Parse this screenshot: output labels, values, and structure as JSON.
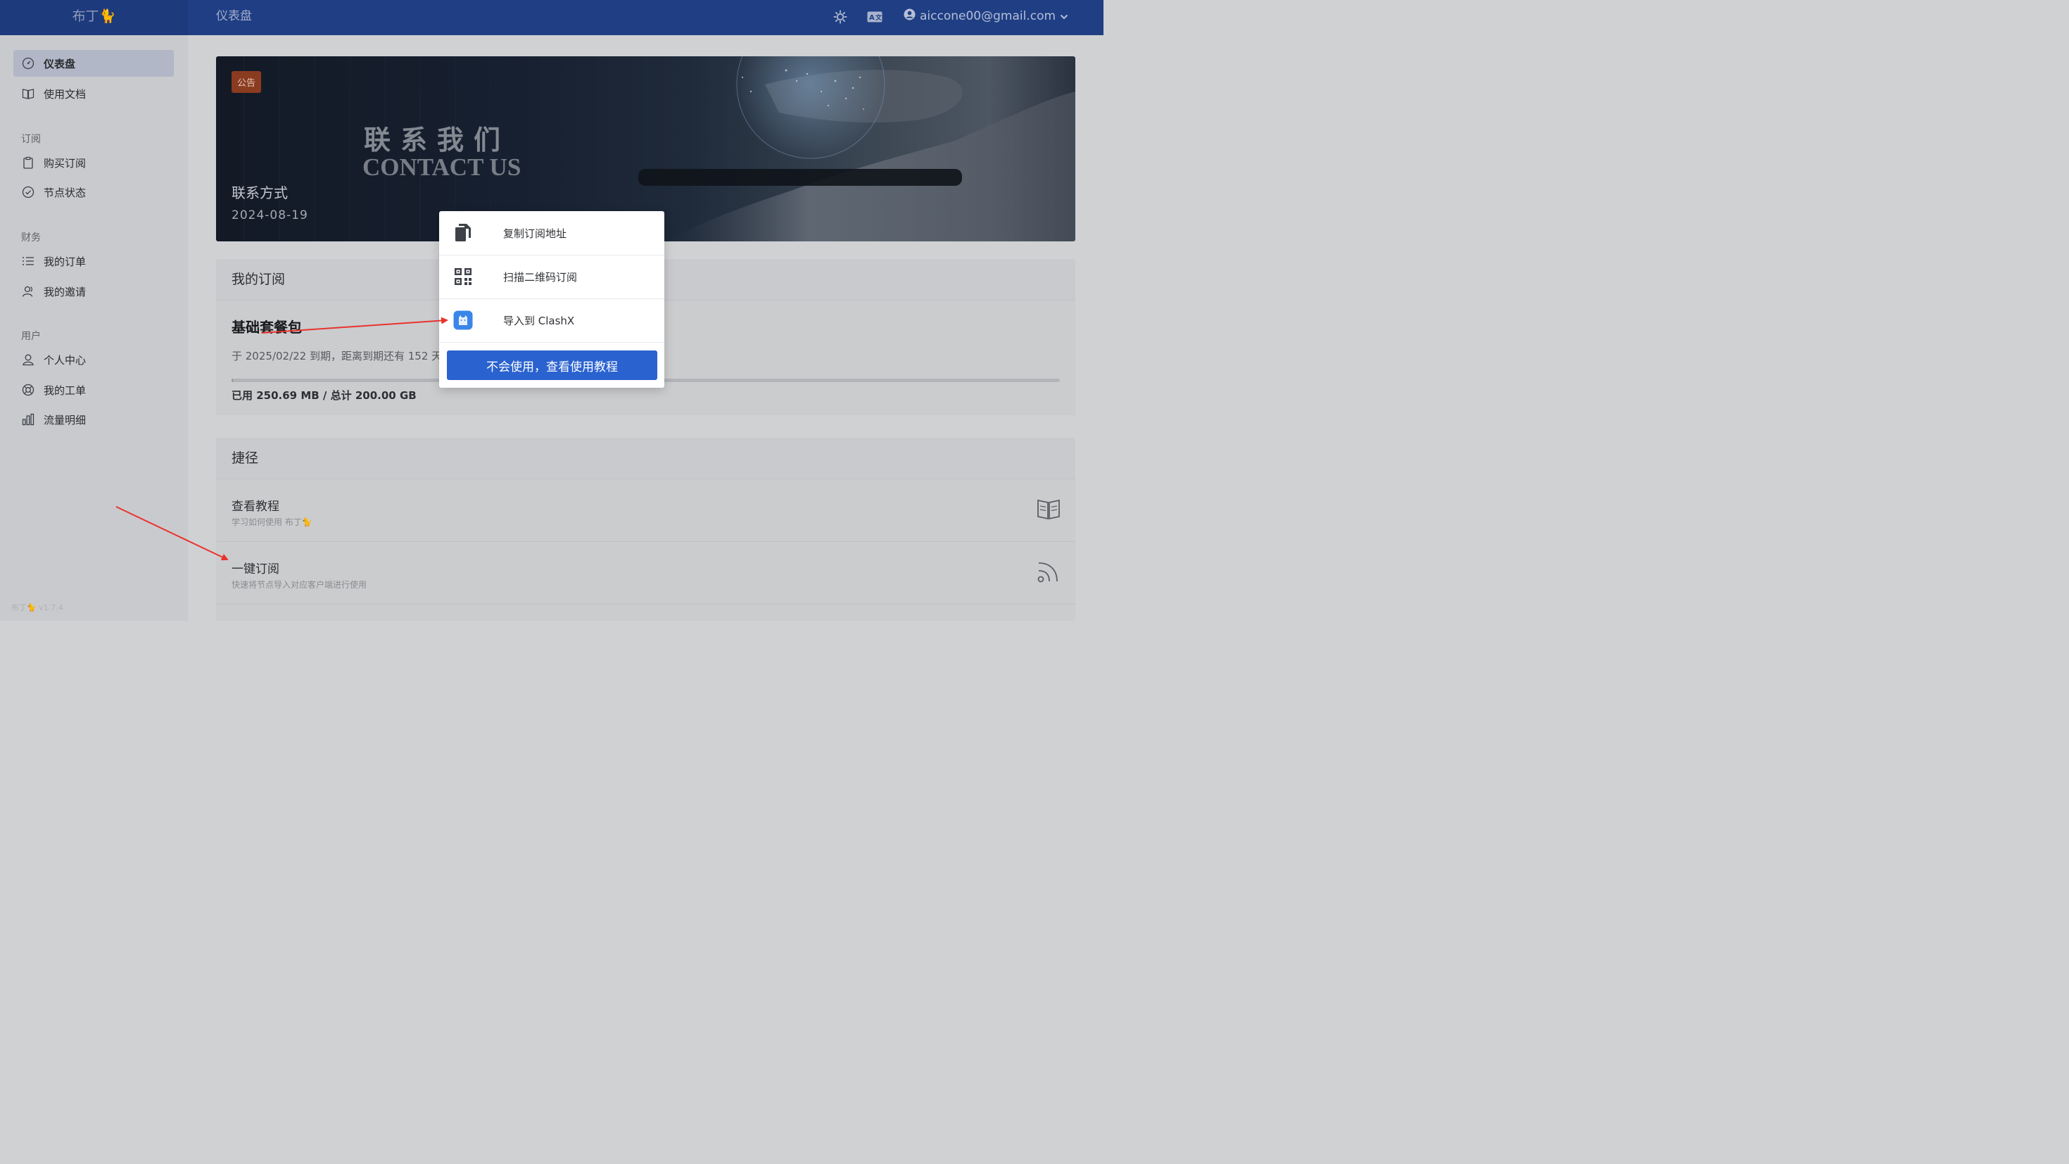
{
  "header": {
    "brand": "布丁🐈",
    "page_title": "仪表盘",
    "user_email": "aiccone00@gmail.com",
    "icons": [
      "theme-sun-icon",
      "language-translate-icon",
      "user-circle-icon",
      "chevron-down-icon"
    ]
  },
  "sidebar": {
    "items": [
      {
        "label": "仪表盘",
        "icon": "dashboard-gauge-icon",
        "active": true
      },
      {
        "label": "使用文档",
        "icon": "book-icon"
      }
    ],
    "groups": [
      {
        "title": "订阅",
        "items": [
          {
            "label": "购买订阅",
            "icon": "clipboard-icon"
          },
          {
            "label": "节点状态",
            "icon": "check-circle-icon"
          }
        ]
      },
      {
        "title": "财务",
        "items": [
          {
            "label": "我的订单",
            "icon": "list-icon"
          },
          {
            "label": "我的邀请",
            "icon": "users-icon"
          }
        ]
      },
      {
        "title": "用户",
        "items": [
          {
            "label": "个人中心",
            "icon": "user-icon"
          },
          {
            "label": "我的工单",
            "icon": "support-lifebuoy-icon"
          },
          {
            "label": "流量明细",
            "icon": "bar-chart-icon"
          }
        ]
      }
    ],
    "version": "布丁🐈 v1.7.4"
  },
  "banner": {
    "badge": "公告",
    "art_cn": "联系我们",
    "art_en": "CONTACT US",
    "title": "联系方式",
    "date": "2024-08-19"
  },
  "subscription": {
    "heading": "我的订阅",
    "plan_name": "基础套餐包",
    "expire_text": "于 2025/02/22 到期，距离到期还有 152 天。",
    "usage_text": "已用 250.69 MB / 总计 200.00 GB",
    "usage_fraction": 0.0012
  },
  "shortcuts": {
    "heading": "捷径",
    "items": [
      {
        "title": "查看教程",
        "subtitle": "学习如何使用 布丁🐈",
        "icon": "book-open-icon"
      },
      {
        "title": "一键订阅",
        "subtitle": "快速将节点导入对应客户端进行使用",
        "icon": "rss-feed-icon"
      }
    ]
  },
  "popup": {
    "items": [
      {
        "label": "复制订阅地址",
        "icon": "copy-icon"
      },
      {
        "label": "扫描二维码订阅",
        "icon": "qrcode-icon"
      },
      {
        "label": "导入到 ClashX",
        "icon": "clashx-cat-icon"
      }
    ],
    "help_button": "不会使用，查看使用教程"
  },
  "colors": {
    "header_bg": "#1f3e84",
    "primary_button": "#2a62cf",
    "badge": "#8b3b20",
    "annotation_arrow": "#e8332d"
  }
}
